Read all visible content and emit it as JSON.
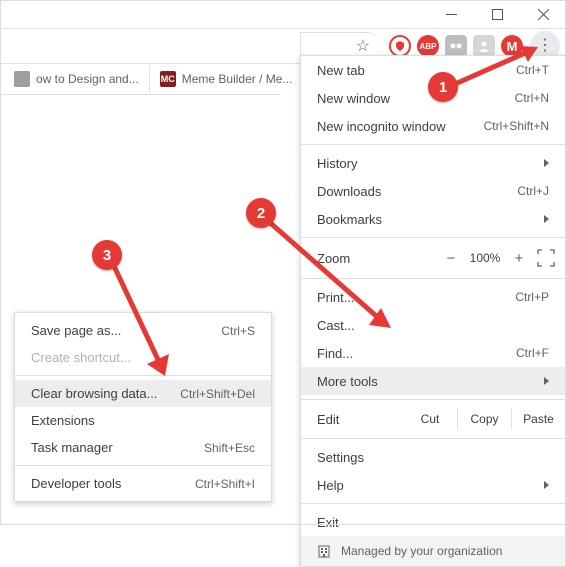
{
  "window_controls": {
    "minimize": "minimize",
    "maximize": "maximize",
    "close": "close"
  },
  "toolbar": {
    "star_title": "Bookmark this tab",
    "extensions": [
      {
        "glyph": "",
        "name": "ublock-origin"
      },
      {
        "glyph": "ABP",
        "name": "adblock-plus"
      },
      {
        "glyph": "",
        "name": "extension-a"
      },
      {
        "glyph": "",
        "name": "extension-b"
      }
    ],
    "profile_initial": "M",
    "menu_button_title": "Customize and control Google Chrome"
  },
  "tabs": [
    {
      "favicon_letter": "",
      "title": "ow to Design and..."
    },
    {
      "favicon_letter": "MC",
      "title": "Meme Builder / Me..."
    }
  ],
  "main_menu": {
    "new_tab": {
      "label": "New tab",
      "shortcut": "Ctrl+T"
    },
    "new_window": {
      "label": "New window",
      "shortcut": "Ctrl+N"
    },
    "incognito": {
      "label": "New incognito window",
      "shortcut": "Ctrl+Shift+N"
    },
    "history": {
      "label": "History"
    },
    "downloads": {
      "label": "Downloads",
      "shortcut": "Ctrl+J"
    },
    "bookmarks": {
      "label": "Bookmarks"
    },
    "zoom": {
      "label": "Zoom",
      "minus": "−",
      "value": "100%",
      "plus": "+"
    },
    "print": {
      "label": "Print...",
      "shortcut": "Ctrl+P"
    },
    "cast": {
      "label": "Cast..."
    },
    "find": {
      "label": "Find...",
      "shortcut": "Ctrl+F"
    },
    "more_tools": {
      "label": "More tools"
    },
    "edit": {
      "label": "Edit",
      "cut": "Cut",
      "copy": "Copy",
      "paste": "Paste"
    },
    "settings": {
      "label": "Settings"
    },
    "help": {
      "label": "Help"
    },
    "exit": {
      "label": "Exit"
    },
    "managed": "Managed by your organization"
  },
  "sub_menu": {
    "save_page": {
      "label": "Save page as...",
      "shortcut": "Ctrl+S"
    },
    "create_shortcut": {
      "label": "Create shortcut..."
    },
    "clear_data": {
      "label": "Clear browsing data...",
      "shortcut": "Ctrl+Shift+Del"
    },
    "extensions": {
      "label": "Extensions"
    },
    "task_manager": {
      "label": "Task manager",
      "shortcut": "Shift+Esc"
    },
    "dev_tools": {
      "label": "Developer tools",
      "shortcut": "Ctrl+Shift+I"
    }
  },
  "badges": {
    "b1": "1",
    "b2": "2",
    "b3": "3"
  }
}
